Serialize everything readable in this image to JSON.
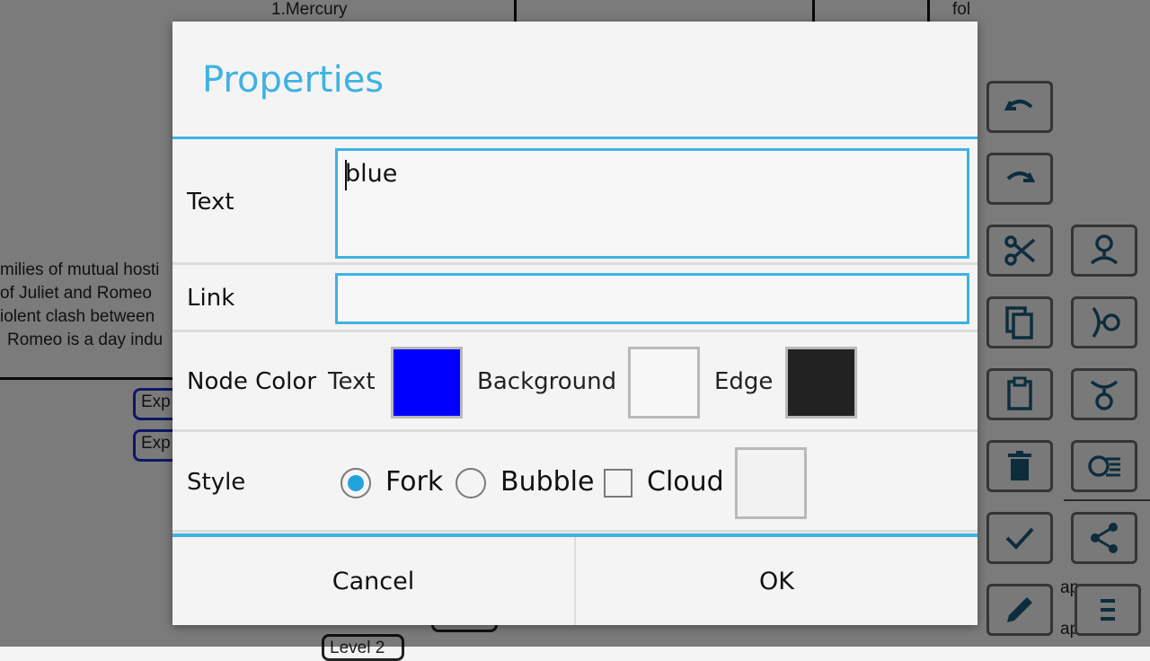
{
  "background": {
    "top_nodes": [
      "1.Mercury",
      "fol"
    ],
    "paragraph_lines": [
      "milies of mutual hosti",
      "of Juliet and Romeo",
      "iolent clash between",
      "Romeo is a day indu"
    ],
    "expand_labels": [
      "Exp",
      "Exp"
    ],
    "bottom_labels": [
      "Level 2",
      "ap",
      "ap"
    ]
  },
  "toolbar": {
    "icons": [
      "undo-icon",
      "redo-icon",
      "cut-icon",
      "add-child-icon",
      "copy-icon",
      "add-sibling-icon",
      "paste-icon",
      "add-parent-icon",
      "delete-icon",
      "outline-icon",
      "check-icon",
      "share-icon",
      "edit-icon",
      "menu-icon"
    ]
  },
  "dialog": {
    "title": "Properties",
    "text_label": "Text",
    "text_value": "blue",
    "link_label": "Link",
    "link_value": "",
    "node_color_label": "Node Color",
    "color_text_label": "Text",
    "color_background_label": "Background",
    "color_edge_label": "Edge",
    "colors": {
      "text": "#0000ff",
      "background": "#f7f7f7",
      "edge": "#222222",
      "style_swatch": "#f2f2f2",
      "accent": "#3fb2e2"
    },
    "style_label": "Style",
    "style_fork": "Fork",
    "style_bubble": "Bubble",
    "style_cloud": "Cloud",
    "selected_style": "Fork",
    "cloud_checked": false,
    "cancel_label": "Cancel",
    "ok_label": "OK"
  }
}
